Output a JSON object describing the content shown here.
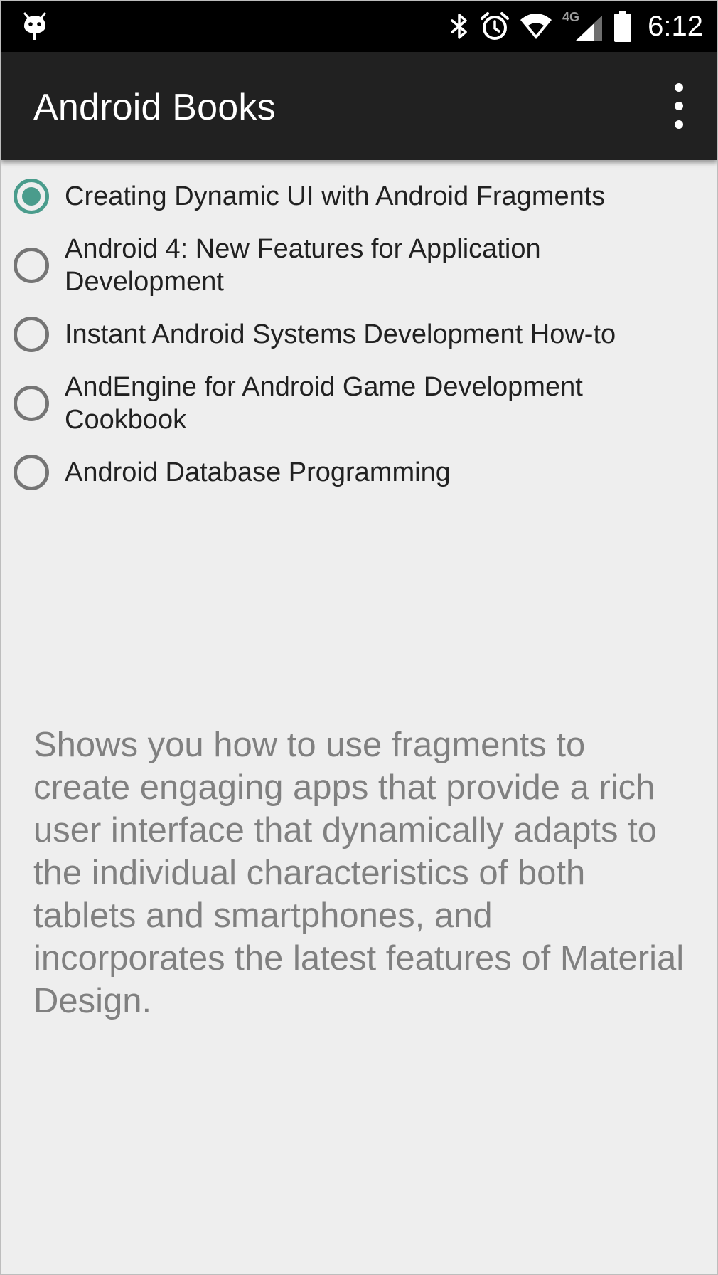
{
  "status_bar": {
    "time": "6:12",
    "network": "4G",
    "icons": [
      "android-notification-icon",
      "bluetooth-icon",
      "alarm-icon",
      "wifi-icon",
      "signal-icon",
      "battery-icon"
    ]
  },
  "app_bar": {
    "title": "Android Books",
    "overflow_icon": "more-vert-icon"
  },
  "books": [
    {
      "title": "Creating Dynamic UI with Android Fragments",
      "selected": true
    },
    {
      "title": "Android 4: New Features for Application Development",
      "selected": false
    },
    {
      "title": "Instant Android Systems Development How-to",
      "selected": false
    },
    {
      "title": "AndEngine for Android Game Development Cookbook",
      "selected": false
    },
    {
      "title": "Android Database Programming",
      "selected": false
    }
  ],
  "description": "Shows you how to use fragments to create engaging apps that provide a rich user interface that dynamically adapts to the individual characteristics of both tablets and smartphones, and incorporates the latest features of Material Design.",
  "colors": {
    "accent": "#4a9c8c",
    "app_bar": "#212121",
    "status_bar": "#000000",
    "background": "#eeeeee",
    "description_text": "#808080"
  }
}
